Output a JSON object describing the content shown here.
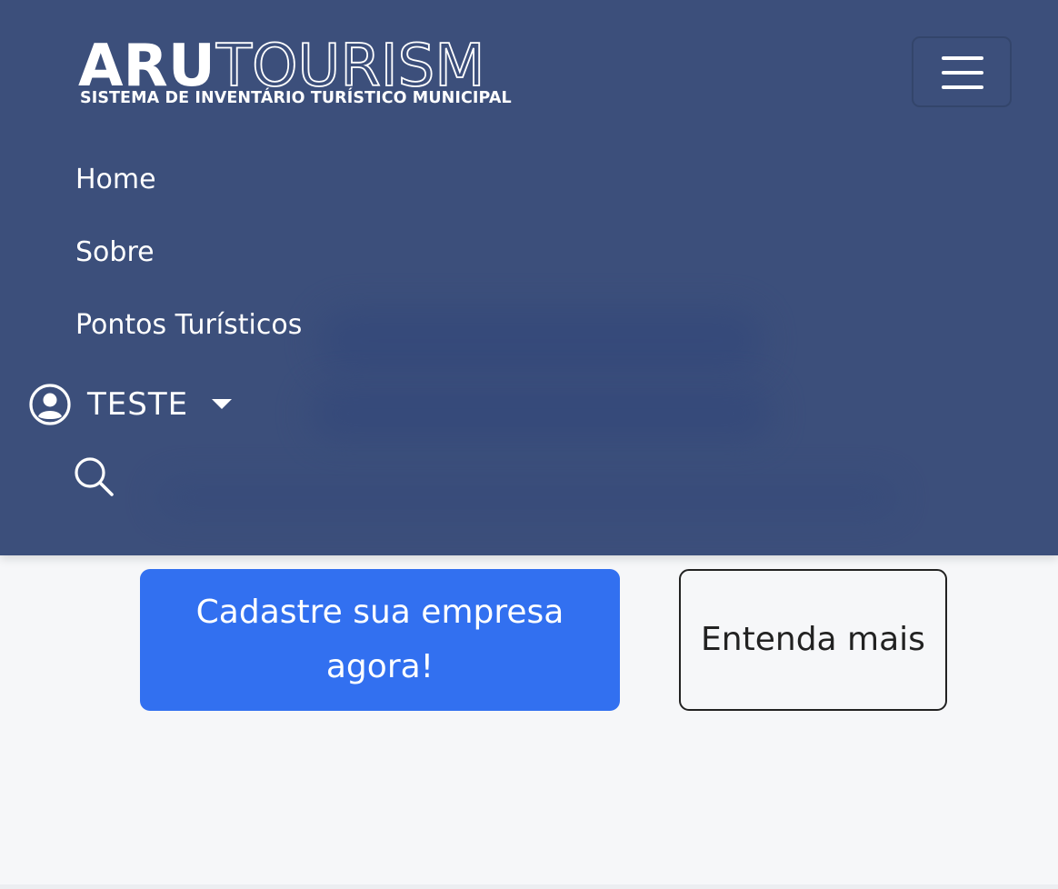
{
  "brand": {
    "name_bold": "ARU",
    "name_outline": "TOURISM",
    "subtitle": "SISTEMA DE INVENTÁRIO TURÍSTICO MUNICIPAL"
  },
  "nav": {
    "items": [
      {
        "label": "Home"
      },
      {
        "label": "Sobre"
      },
      {
        "label": "Pontos Turísticos"
      }
    ],
    "user": {
      "name": "TESTE"
    }
  },
  "hero": {
    "primary_button": "Cadastre sua empresa agora!",
    "secondary_button": "Entenda mais"
  },
  "colors": {
    "navbar": "#3c4f7b",
    "primary": "#3270f0",
    "background": "#f6f7f9"
  },
  "icons": [
    "menu-icon",
    "user-circle-icon",
    "caret-down-icon",
    "search-icon"
  ]
}
